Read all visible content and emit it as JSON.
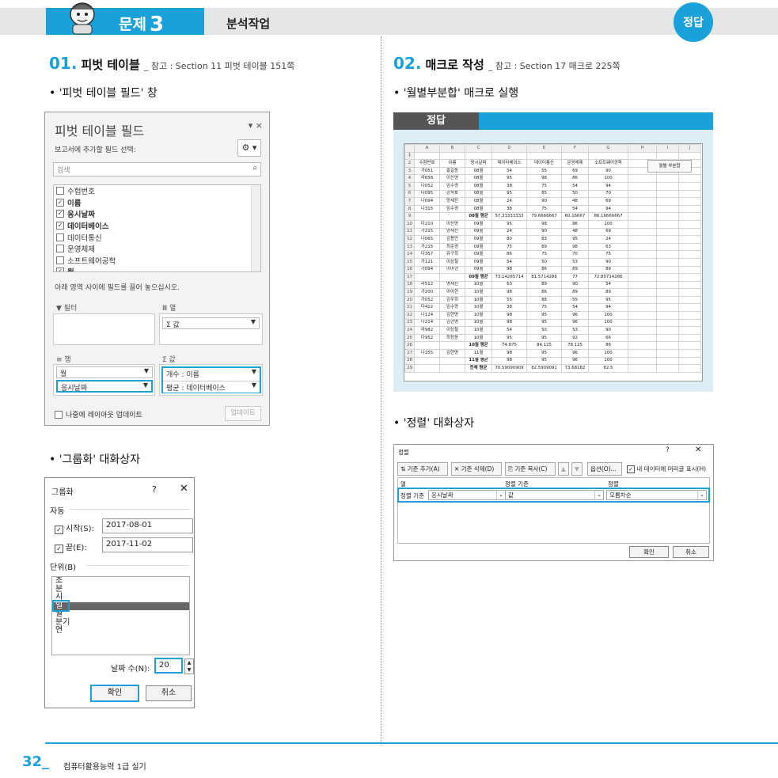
{
  "header": {
    "problem_label": "문제",
    "problem_number": "3",
    "title": "분석작업",
    "answer_badge": "정답"
  },
  "section1": {
    "num": "01.",
    "title": "피벗 테이블",
    "ref": "_ 참고 : Section 11 피벗 테이블 151쪽",
    "bullet_pivot": "• '피벗 테이블 필드' 창",
    "bullet_group": "• '그룹화' 대화상자"
  },
  "section2": {
    "num": "02.",
    "title": "매크로 작성",
    "ref": "_ 참고 : Section 17 매크로 225쪽",
    "bullet_macro": "• '월별부분합' 매크로 실행",
    "bullet_sort": "• '정렬' 대화상자",
    "answer_tab": "정답"
  },
  "pivot_panel": {
    "title": "피벗 테이블 필드",
    "controls": "▾ ×",
    "subtitle": "보고서에 추가할 필드 선택:",
    "search_placeholder": "검색",
    "fields": [
      {
        "label": "수험번호",
        "checked": false
      },
      {
        "label": "이름",
        "checked": true
      },
      {
        "label": "응시날짜",
        "checked": true
      },
      {
        "label": "데이터베이스",
        "checked": true
      },
      {
        "label": "데이터통신",
        "checked": false
      },
      {
        "label": "운영체제",
        "checked": false
      },
      {
        "label": "소프트웨어공학",
        "checked": false
      },
      {
        "label": "월",
        "checked": true
      }
    ],
    "drag_hint": "아래 영역 사이에 필드를 끌어 놓으십시오.",
    "zone_filter": "▼ 필터",
    "zone_columns": "Ⅲ 열",
    "zone_rows": "≡ 행",
    "zone_values": "Σ 값",
    "columns_item": "Σ 값",
    "rows_items": [
      "월",
      "응시날짜"
    ],
    "values_items": [
      "개수 : 이름",
      "평균 : 데이터베이스"
    ],
    "defer_update": "나중에 레이아웃 업데이트",
    "update_button": "업데이트"
  },
  "group_dialog": {
    "title": "그룹화",
    "help": "?",
    "close": "✕",
    "auto_label": "자동",
    "start_label": "시작(S):",
    "start_value": "2017-08-01",
    "end_label": "끝(E):",
    "end_value": "2017-11-02",
    "unit_label": "단위(B)",
    "units": [
      "초",
      "분",
      "시",
      "일",
      "월",
      "분기",
      "연"
    ],
    "selected_unit": "일",
    "days_label": "날짜 수(N):",
    "days_value": "20",
    "ok": "확인",
    "cancel": "취소"
  },
  "sheet": {
    "col_headers": [
      "",
      "A",
      "B",
      "C",
      "D",
      "E",
      "F",
      "G",
      "H",
      "I",
      "J"
    ],
    "macro_button": "월별 부분합",
    "rows": [
      [
        "1",
        "",
        "",
        "",
        "",
        "",
        "",
        ""
      ],
      [
        "2",
        "수험번호",
        "이름",
        "응시날짜",
        "데이터베이스",
        "데이터통신",
        "운영체제",
        "소프트웨어공학"
      ],
      [
        "3",
        "가051",
        "홍길동",
        "08월",
        "54",
        "55",
        "69",
        "90"
      ],
      [
        "4",
        "라658",
        "이신영",
        "08월",
        "95",
        "98",
        "86",
        "100"
      ],
      [
        "5",
        "나052",
        "임수경",
        "08월",
        "38",
        "75",
        "54",
        "94"
      ],
      [
        "6",
        "다095",
        "강석호",
        "08월",
        "95",
        "85",
        "50",
        "70"
      ],
      [
        "7",
        "나094",
        "양세진",
        "08월",
        "24",
        "90",
        "48",
        "69"
      ],
      [
        "8",
        "나315",
        "임수경",
        "08월",
        "38",
        "75",
        "54",
        "94"
      ],
      [
        "9",
        "",
        "",
        "08월 평균",
        "57.33333333",
        "79.6666667",
        "60.16667",
        "86.16666667"
      ],
      [
        "10",
        "다210",
        "이신영",
        "09월",
        "95",
        "98",
        "86",
        "100"
      ],
      [
        "11",
        "가215",
        "양세진",
        "09월",
        "24",
        "90",
        "48",
        "69"
      ],
      [
        "12",
        "나065",
        "김용민",
        "09월",
        "80",
        "83",
        "95",
        "24"
      ],
      [
        "13",
        "가215",
        "최준경",
        "09월",
        "75",
        "89",
        "98",
        "63"
      ],
      [
        "14",
        "다357",
        "유구희",
        "09월",
        "86",
        "75",
        "70",
        "75"
      ],
      [
        "15",
        "가121",
        "이상철",
        "09월",
        "54",
        "50",
        "53",
        "90"
      ],
      [
        "16",
        "가094",
        "이아현",
        "09월",
        "98",
        "86",
        "89",
        "89"
      ],
      [
        "17",
        "",
        "",
        "09월 평균",
        "73.14285714",
        "81.5714286",
        "77",
        "72.85714286"
      ],
      [
        "18",
        "라512",
        "명세진",
        "10월",
        "63",
        "89",
        "90",
        "54"
      ],
      [
        "19",
        "가200",
        "이아현",
        "10월",
        "98",
        "86",
        "89",
        "89"
      ],
      [
        "20",
        "가052",
        "김우희",
        "10월",
        "55",
        "88",
        "55",
        "95"
      ],
      [
        "21",
        "다412",
        "임수경",
        "10월",
        "38",
        "75",
        "54",
        "94"
      ],
      [
        "22",
        "나124",
        "김현명",
        "10월",
        "98",
        "95",
        "96",
        "100"
      ],
      [
        "23",
        "나214",
        "김현명",
        "10월",
        "98",
        "95",
        "96",
        "100"
      ],
      [
        "24",
        "라982",
        "이상철",
        "10월",
        "54",
        "50",
        "53",
        "90"
      ],
      [
        "25",
        "다952",
        "최정윤",
        "10월",
        "95",
        "95",
        "92",
        "66"
      ],
      [
        "26",
        "",
        "",
        "10월 평균",
        "74.875",
        "84.125",
        "78.125",
        "86"
      ],
      [
        "27",
        "나255",
        "김현명",
        "11월",
        "98",
        "95",
        "96",
        "100"
      ],
      [
        "28",
        "",
        "",
        "11월 평균",
        "98",
        "95",
        "96",
        "100"
      ],
      [
        "29",
        "",
        "",
        "전체 평균",
        "70.59090909",
        "82.5909091",
        "73.68182",
        "82.5"
      ]
    ]
  },
  "sort_dialog": {
    "title": "정렬",
    "help": "?",
    "close": "✕",
    "add_level": "기준 추가(A)",
    "delete_level": "기준 삭제(D)",
    "copy_level": "기준 복사(C)",
    "options": "옵션(O)...",
    "header_check": "내 데이터에 머리글 표시(H)",
    "col_header": "열",
    "sort_on_header": "정렬 기준",
    "order_header": "정렬",
    "row_label": "정렬 기준",
    "row_column": "응시날짜",
    "row_sort_on": "값",
    "row_order": "오름차순",
    "ok": "확인",
    "cancel": "취소"
  },
  "footer": {
    "page": "32_",
    "book": "컴퓨터활용능력 1급 실기"
  }
}
